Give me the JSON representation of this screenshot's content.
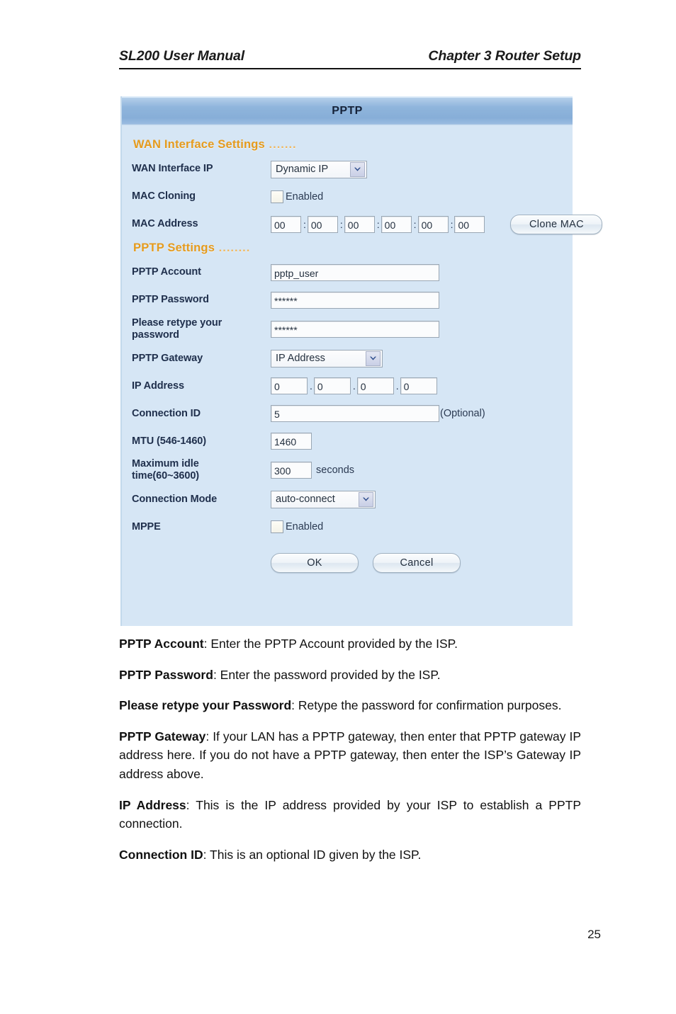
{
  "header": {
    "left": "SL200 User Manual",
    "right": "Chapter 3 Router Setup"
  },
  "screenshot": {
    "title": "PPTP",
    "sections": {
      "wan": {
        "label": "WAN Interface Settings",
        "dots": " ......."
      },
      "pptp": {
        "label": "PPTP Settings",
        "dots": " ........"
      }
    },
    "fields": {
      "wan_interface_ip": {
        "label": "WAN Interface IP",
        "value": "Dynamic IP"
      },
      "mac_cloning": {
        "label": "MAC Cloning",
        "checkbox_label": "Enabled",
        "checked": false
      },
      "mac_address": {
        "label": "MAC Address",
        "octets": [
          "00",
          "00",
          "00",
          "00",
          "00",
          "00"
        ],
        "separator": ":",
        "button": "Clone MAC"
      },
      "pptp_account": {
        "label": "PPTP Account",
        "value": "pptp_user"
      },
      "pptp_password": {
        "label": "PPTP Password",
        "value": "******"
      },
      "retype_password": {
        "label_line1": "Please retype your",
        "label_line2": "password",
        "value": "******"
      },
      "pptp_gateway": {
        "label": "PPTP Gateway",
        "value": "IP Address"
      },
      "ip_address": {
        "label": "IP Address",
        "octets": [
          "0",
          "0",
          "0",
          "0"
        ],
        "separator": "."
      },
      "connection_id": {
        "label": "Connection ID",
        "value": "5",
        "hint": "(Optional)"
      },
      "mtu": {
        "label": "MTU (546-1460)",
        "value": "1460"
      },
      "max_idle": {
        "label_line1": "Maximum idle",
        "label_line2": "time(60~3600)",
        "value": "300",
        "unit": "seconds"
      },
      "connection_mode": {
        "label": "Connection Mode",
        "value": "auto-connect"
      },
      "mppe": {
        "label": "MPPE",
        "checkbox_label": "Enabled",
        "checked": false
      }
    },
    "buttons": {
      "ok": "OK",
      "cancel": "Cancel"
    },
    "colors": {
      "titlebar": "#8fb5dc",
      "panel_bg": "#d6e6f5",
      "section_heading": "#e59b1e"
    }
  },
  "prose": {
    "p1_term": "PPTP Account",
    "p1_text": ":  Enter the PPTP Account provided by the ISP.",
    "p2_term": "PPTP Password",
    "p2_text": ": Enter the password provided by the ISP.",
    "p3_term": "Please retype your Password",
    "p3_text": ": Retype the password for confirmation purposes.",
    "p4_term": "PPTP Gateway",
    "p4_text": ": If your LAN has a PPTP gateway, then enter that  PPTP gateway IP address here. If you do not have a PPTP gateway, then enter the ISP’s  Gateway  IP address above.",
    "p5_term": "IP Address",
    "p5_text": ": This is the IP address provided by your ISP to establish a PPTP connection.",
    "p6_term": "Connection ID",
    "p6_text": ": This is an optional ID given by the ISP."
  },
  "page_number": "25"
}
